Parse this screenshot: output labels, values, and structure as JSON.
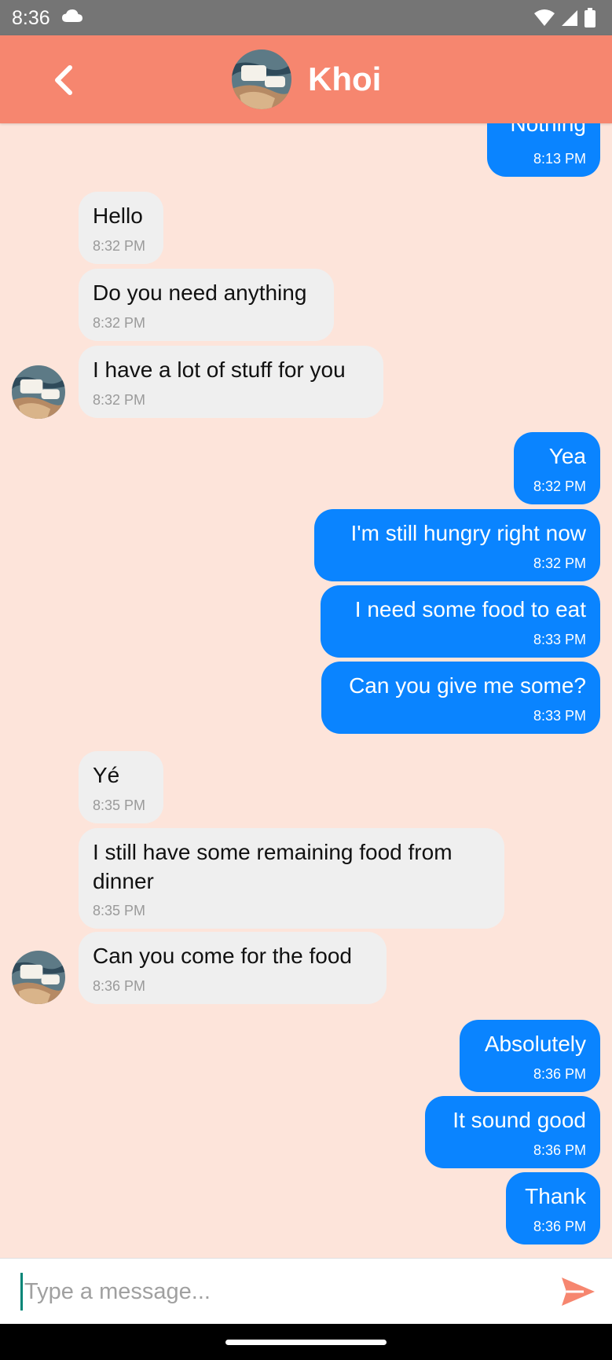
{
  "status_bar": {
    "time": "8:36"
  },
  "header": {
    "contact_name": "Khoi"
  },
  "messages": [
    {
      "side": "out",
      "text": "Nothing",
      "time": "8:13 PM"
    },
    {
      "side": "in",
      "text": "Hello",
      "time": "8:32 PM"
    },
    {
      "side": "in",
      "text": "Do you need anything",
      "time": "8:32 PM"
    },
    {
      "side": "in",
      "text": "I have a lot of stuff for you",
      "time": "8:32 PM"
    },
    {
      "side": "out",
      "text": "Yea",
      "time": "8:32 PM"
    },
    {
      "side": "out",
      "text": "I'm still hungry right now",
      "time": "8:32 PM"
    },
    {
      "side": "out",
      "text": "I need some food to eat",
      "time": "8:33 PM"
    },
    {
      "side": "out",
      "text": "Can you give me some?",
      "time": "8:33 PM"
    },
    {
      "side": "in",
      "text": "Yé",
      "time": "8:35 PM"
    },
    {
      "side": "in",
      "text": "I still have some remaining food from dinner",
      "time": "8:35 PM"
    },
    {
      "side": "in",
      "text": "Can you come for the food",
      "time": "8:36 PM"
    },
    {
      "side": "out",
      "text": "Absolutely",
      "time": "8:36 PM"
    },
    {
      "side": "out",
      "text": "It sound good",
      "time": "8:36 PM"
    },
    {
      "side": "out",
      "text": "Thank",
      "time": "8:36 PM"
    }
  ],
  "composer": {
    "placeholder": "Type a message..."
  },
  "colors": {
    "header": "#f6866f",
    "background": "#fde4da",
    "outgoing": "#0a84ff",
    "incoming": "#efefef",
    "send": "#f6866f"
  }
}
